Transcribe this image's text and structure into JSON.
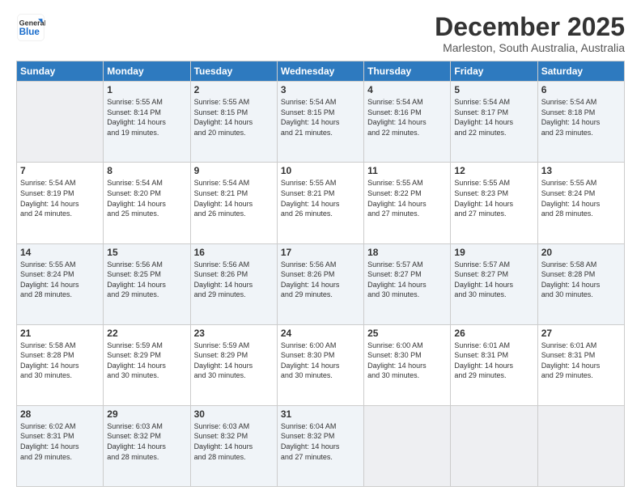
{
  "logo": {
    "line1": "General",
    "line2": "Blue"
  },
  "header": {
    "month": "December 2025",
    "location": "Marleston, South Australia, Australia"
  },
  "weekdays": [
    "Sunday",
    "Monday",
    "Tuesday",
    "Wednesday",
    "Thursday",
    "Friday",
    "Saturday"
  ],
  "weeks": [
    [
      {
        "day": "",
        "info": ""
      },
      {
        "day": "1",
        "info": "Sunrise: 5:55 AM\nSunset: 8:14 PM\nDaylight: 14 hours\nand 19 minutes."
      },
      {
        "day": "2",
        "info": "Sunrise: 5:55 AM\nSunset: 8:15 PM\nDaylight: 14 hours\nand 20 minutes."
      },
      {
        "day": "3",
        "info": "Sunrise: 5:54 AM\nSunset: 8:15 PM\nDaylight: 14 hours\nand 21 minutes."
      },
      {
        "day": "4",
        "info": "Sunrise: 5:54 AM\nSunset: 8:16 PM\nDaylight: 14 hours\nand 22 minutes."
      },
      {
        "day": "5",
        "info": "Sunrise: 5:54 AM\nSunset: 8:17 PM\nDaylight: 14 hours\nand 22 minutes."
      },
      {
        "day": "6",
        "info": "Sunrise: 5:54 AM\nSunset: 8:18 PM\nDaylight: 14 hours\nand 23 minutes."
      }
    ],
    [
      {
        "day": "7",
        "info": "Sunrise: 5:54 AM\nSunset: 8:19 PM\nDaylight: 14 hours\nand 24 minutes."
      },
      {
        "day": "8",
        "info": "Sunrise: 5:54 AM\nSunset: 8:20 PM\nDaylight: 14 hours\nand 25 minutes."
      },
      {
        "day": "9",
        "info": "Sunrise: 5:54 AM\nSunset: 8:21 PM\nDaylight: 14 hours\nand 26 minutes."
      },
      {
        "day": "10",
        "info": "Sunrise: 5:55 AM\nSunset: 8:21 PM\nDaylight: 14 hours\nand 26 minutes."
      },
      {
        "day": "11",
        "info": "Sunrise: 5:55 AM\nSunset: 8:22 PM\nDaylight: 14 hours\nand 27 minutes."
      },
      {
        "day": "12",
        "info": "Sunrise: 5:55 AM\nSunset: 8:23 PM\nDaylight: 14 hours\nand 27 minutes."
      },
      {
        "day": "13",
        "info": "Sunrise: 5:55 AM\nSunset: 8:24 PM\nDaylight: 14 hours\nand 28 minutes."
      }
    ],
    [
      {
        "day": "14",
        "info": "Sunrise: 5:55 AM\nSunset: 8:24 PM\nDaylight: 14 hours\nand 28 minutes."
      },
      {
        "day": "15",
        "info": "Sunrise: 5:56 AM\nSunset: 8:25 PM\nDaylight: 14 hours\nand 29 minutes."
      },
      {
        "day": "16",
        "info": "Sunrise: 5:56 AM\nSunset: 8:26 PM\nDaylight: 14 hours\nand 29 minutes."
      },
      {
        "day": "17",
        "info": "Sunrise: 5:56 AM\nSunset: 8:26 PM\nDaylight: 14 hours\nand 29 minutes."
      },
      {
        "day": "18",
        "info": "Sunrise: 5:57 AM\nSunset: 8:27 PM\nDaylight: 14 hours\nand 30 minutes."
      },
      {
        "day": "19",
        "info": "Sunrise: 5:57 AM\nSunset: 8:27 PM\nDaylight: 14 hours\nand 30 minutes."
      },
      {
        "day": "20",
        "info": "Sunrise: 5:58 AM\nSunset: 8:28 PM\nDaylight: 14 hours\nand 30 minutes."
      }
    ],
    [
      {
        "day": "21",
        "info": "Sunrise: 5:58 AM\nSunset: 8:28 PM\nDaylight: 14 hours\nand 30 minutes."
      },
      {
        "day": "22",
        "info": "Sunrise: 5:59 AM\nSunset: 8:29 PM\nDaylight: 14 hours\nand 30 minutes."
      },
      {
        "day": "23",
        "info": "Sunrise: 5:59 AM\nSunset: 8:29 PM\nDaylight: 14 hours\nand 30 minutes."
      },
      {
        "day": "24",
        "info": "Sunrise: 6:00 AM\nSunset: 8:30 PM\nDaylight: 14 hours\nand 30 minutes."
      },
      {
        "day": "25",
        "info": "Sunrise: 6:00 AM\nSunset: 8:30 PM\nDaylight: 14 hours\nand 30 minutes."
      },
      {
        "day": "26",
        "info": "Sunrise: 6:01 AM\nSunset: 8:31 PM\nDaylight: 14 hours\nand 29 minutes."
      },
      {
        "day": "27",
        "info": "Sunrise: 6:01 AM\nSunset: 8:31 PM\nDaylight: 14 hours\nand 29 minutes."
      }
    ],
    [
      {
        "day": "28",
        "info": "Sunrise: 6:02 AM\nSunset: 8:31 PM\nDaylight: 14 hours\nand 29 minutes."
      },
      {
        "day": "29",
        "info": "Sunrise: 6:03 AM\nSunset: 8:32 PM\nDaylight: 14 hours\nand 28 minutes."
      },
      {
        "day": "30",
        "info": "Sunrise: 6:03 AM\nSunset: 8:32 PM\nDaylight: 14 hours\nand 28 minutes."
      },
      {
        "day": "31",
        "info": "Sunrise: 6:04 AM\nSunset: 8:32 PM\nDaylight: 14 hours\nand 27 minutes."
      },
      {
        "day": "",
        "info": ""
      },
      {
        "day": "",
        "info": ""
      },
      {
        "day": "",
        "info": ""
      }
    ]
  ]
}
